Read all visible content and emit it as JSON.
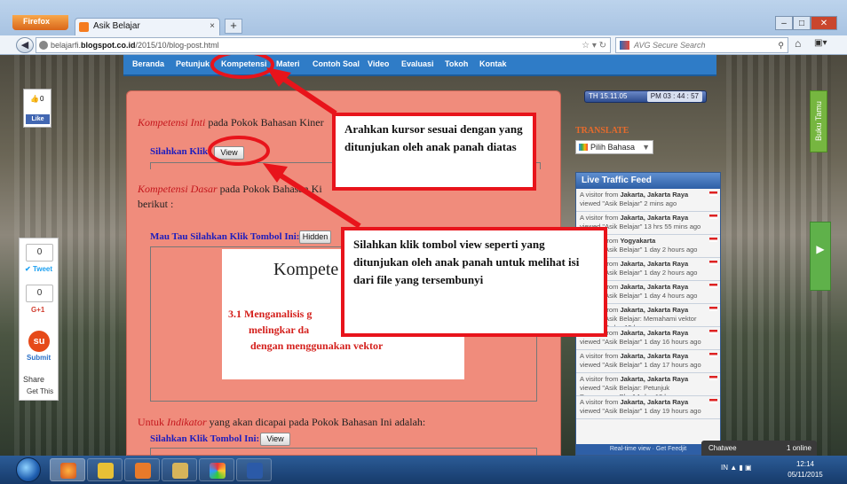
{
  "browser": {
    "menu_label": "Firefox",
    "tab_title": "Asik Belajar",
    "new_tab": "+",
    "url_prefix": "belajarfi.",
    "url_domain": "blogspot.co.id",
    "url_path": "/2015/10/blog-post.html",
    "search_placeholder": "AVG Secure Search"
  },
  "blog_nav": {
    "items": [
      "Beranda",
      "Petunjuk",
      "Kompetensi",
      "Materi",
      "Contoh Soal",
      "Video",
      "Evaluasi",
      "Tokoh",
      "Kontak"
    ]
  },
  "facebook": {
    "count": "0",
    "like": "Like"
  },
  "main": {
    "ki_italic": "Kompetensi Inti",
    "ki_text": "pada Pokok Bahasan Kiner",
    "silahkan_1": "Silahkan Klik:",
    "view_1": "View",
    "kd_italic": "Kompetensi Dasar",
    "kd_text": "pada Pokok Bahasan Ki",
    "kd_cont": "berikut :",
    "mau_tau": "Mau Tau Silahkan Klik Tombol Ini:",
    "hidden_btn": "Hidden",
    "image_title": "Kompete",
    "image_line1": "3.1 Menganalisis g",
    "image_line2": "melingkar  da",
    "image_line3": "dengan menggunakan vektor",
    "indikator_pre": "Untuk",
    "indikator_italic": "Indikator",
    "indikator_post": "yang akan dicapai pada Pokok Bahasan Ini adalah:",
    "silahkan_2": "Silahkan Klik Tombol Ini:",
    "view_2": "View"
  },
  "callouts": {
    "top": "Arahkan kursor sesuai dengan yang ditunjukan oleh anak panah diatas",
    "bottom": "Silahkan klik tombol view seperti yang ditunjukan oleh anak panah untuk melihat isi dari file yang tersembunyi"
  },
  "sidebar": {
    "clock_left": "TH 15.11.05",
    "clock_time": "PM  03 : 44 : 57",
    "translate": "TRANSLATE",
    "lang_select": "Pilih Bahasa",
    "feed_title": "Live Traffic Feed",
    "feed": [
      {
        "a": "A visitor from ",
        "loc": "Jakarta, Jakarta Raya",
        "v": "viewed \"Asik Belajar\" 2 mins ago"
      },
      {
        "a": "A visitor from ",
        "loc": "Jakarta, Jakarta Raya",
        "v": "viewed \"Asik Belajar\" 13 hrs 55 mins ago"
      },
      {
        "a": "A visitor from ",
        "loc": "Yogyakarta",
        "v": "viewed \"Asik Belajar\" 1 day 2 hours ago"
      },
      {
        "a": "A visitor from ",
        "loc": "Jakarta, Jakarta Raya",
        "v": "viewed \"Asik Belajar\" 1 day 2 hours ago"
      },
      {
        "a": "A visitor from ",
        "loc": "Jakarta, Jakarta Raya",
        "v": "viewed \"Asik Belajar\" 1 day 4 hours ago"
      },
      {
        "a": "A visitor from ",
        "loc": "Jakarta, Jakarta Raya",
        "v": "viewed \"Asik Belajar: Memahami vektor pada ...\" 1 day 15 hours ago"
      },
      {
        "a": "A visitor from ",
        "loc": "Jakarta, Jakarta Raya",
        "v": "viewed \"Asik Belajar\" 1 day 16 hours ago"
      },
      {
        "a": "A visitor from ",
        "loc": "Jakarta, Jakarta Raya",
        "v": "viewed \"Asik Belajar\" 1 day 17 hours ago"
      },
      {
        "a": "A visitor from ",
        "loc": "Jakarta, Jakarta Raya",
        "v": "viewed \"Asik Belajar: Petunjuk Penggunaan Blog\" 1 day 18 hours ago"
      },
      {
        "a": "A visitor from ",
        "loc": "Jakarta, Jakarta Raya",
        "v": "viewed \"Asik Belajar\" 1 day 19 hours ago"
      }
    ],
    "feed_footer": "Real-time view · Get Feedjit",
    "buku_tamu": "Buku Tamu"
  },
  "share": {
    "tweet_count": "0",
    "tweet": "Tweet",
    "gplus_count": "0",
    "gplus": "G+1",
    "submit": "Submit",
    "share": "Share",
    "get_this": "Get This"
  },
  "chatwee": {
    "label": "Chatwee",
    "online": "1 online"
  },
  "taskbar": {
    "lang": "IN",
    "time": "12:14",
    "date": "05/11/2015"
  }
}
